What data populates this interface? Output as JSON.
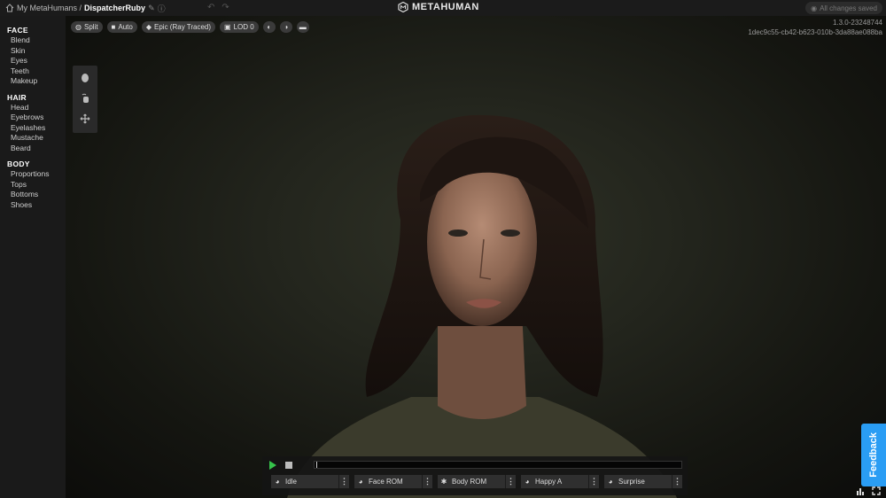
{
  "topbar": {
    "breadcrumb_root": "My MetaHumans /",
    "breadcrumb_current": "DispatcherRuby",
    "logo_text": "METAHUMAN",
    "saved_status": "All changes saved"
  },
  "sidebar": {
    "sections": [
      {
        "title": "FACE",
        "items": [
          "Blend",
          "Skin",
          "Eyes",
          "Teeth",
          "Makeup"
        ]
      },
      {
        "title": "HAIR",
        "items": [
          "Head",
          "Eyebrows",
          "Eyelashes",
          "Mustache",
          "Beard"
        ]
      },
      {
        "title": "BODY",
        "items": [
          "Proportions",
          "Tops",
          "Bottoms",
          "Shoes"
        ]
      }
    ]
  },
  "toolbar": {
    "split_label": "Split",
    "camera_label": "Auto",
    "quality_label": "Epic (Ray Traced)",
    "lod_label": "LOD 0"
  },
  "version": {
    "number": "1.3.0-23248744",
    "id": "1dec9c55-cb42-b623-010b-3da88ae088ba"
  },
  "playback": {
    "animations": [
      "Idle",
      "Face ROM",
      "Body ROM",
      "Happy A",
      "Surprise"
    ]
  },
  "feedback_label": "Feedback",
  "colors": {
    "play": "#35c24a",
    "feedback": "#2a9df4",
    "sidebar_bg": "#1a1a1a"
  },
  "icons": {
    "home": "home-icon",
    "edit": "pencil-icon",
    "help": "help-icon",
    "undo": "undo-icon",
    "redo": "redo-icon",
    "saved": "check-circle-icon"
  }
}
